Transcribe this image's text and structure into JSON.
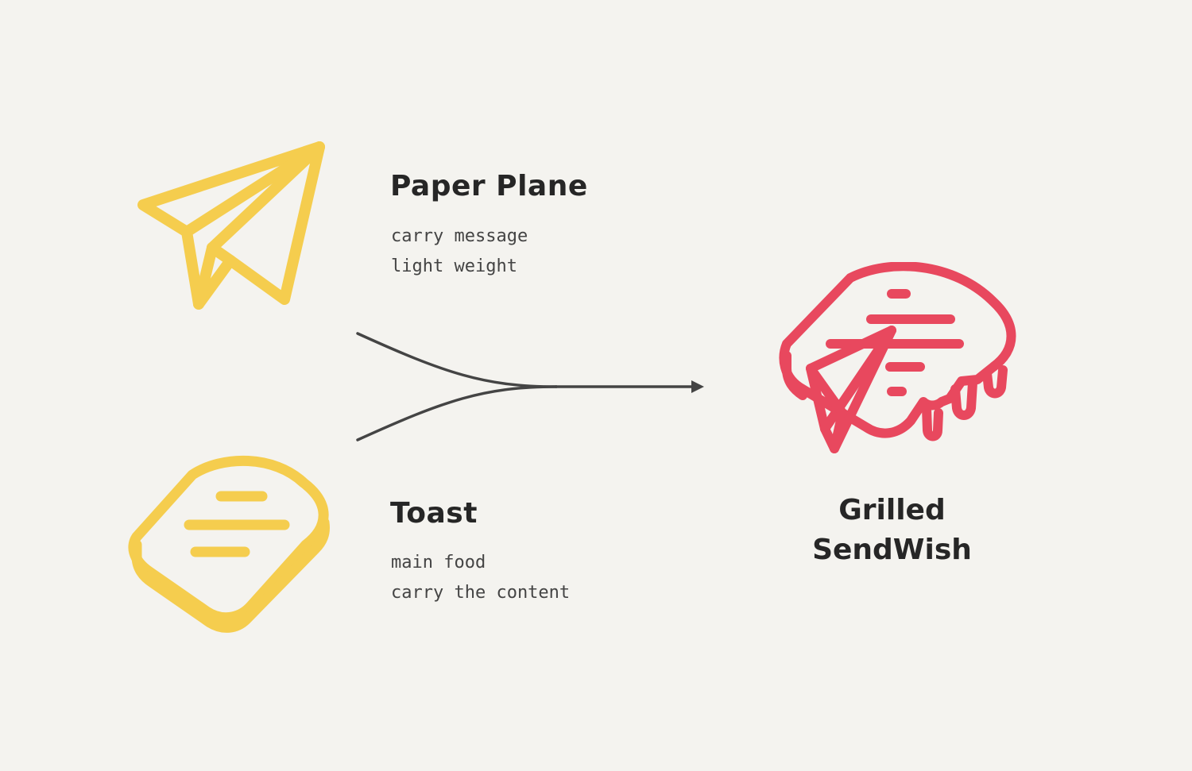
{
  "colors": {
    "background": "#f4f3ef",
    "input_icon": "#f5cd4e",
    "output_icon": "#e8485e",
    "connector": "#444444",
    "text": "#262626"
  },
  "inputs": [
    {
      "icon": "paper-plane-icon",
      "title": "Paper Plane",
      "lines": [
        "carry message",
        "light weight"
      ]
    },
    {
      "icon": "toast-icon",
      "title": "Toast",
      "lines": [
        "main food",
        "carry the content"
      ]
    }
  ],
  "output": {
    "icon": "grilled-sandwich-icon",
    "title_lines": [
      "Grilled",
      "SendWish"
    ]
  }
}
